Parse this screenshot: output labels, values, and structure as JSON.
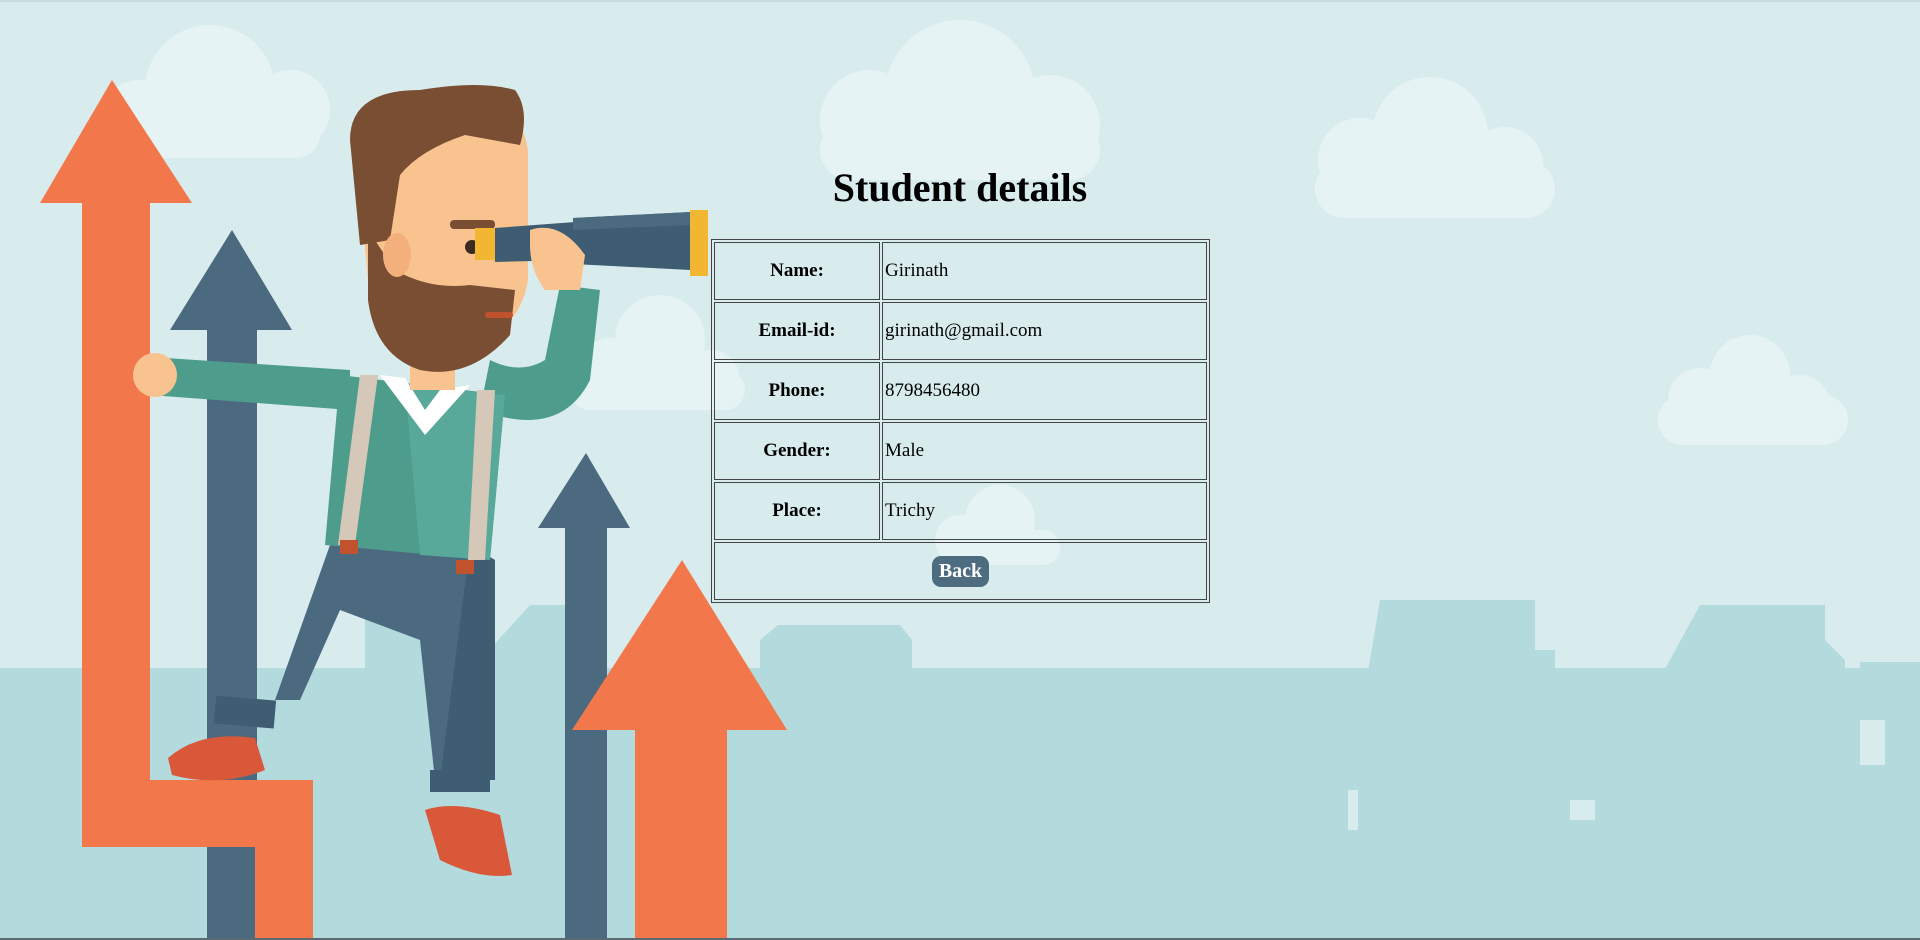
{
  "page": {
    "title": "Student details"
  },
  "details": {
    "rows": [
      {
        "label": "Name:",
        "value": "Girinath"
      },
      {
        "label": "Email-id:",
        "value": "girinath@gmail.com"
      },
      {
        "label": "Phone:",
        "value": "8798456480"
      },
      {
        "label": "Gender:",
        "value": "Male"
      },
      {
        "label": "Place:",
        "value": "Trichy"
      }
    ],
    "back_label": "Back"
  },
  "illustration": {
    "icon": "man-with-telescope-on-arrows-illustration",
    "colors": {
      "sky": "#d8ecee",
      "cloud": "#e6f3f4",
      "city": "#b3dadd",
      "arrow_orange": "#f2784b",
      "arrow_navy": "#4b6a80",
      "shirt": "#4e9d8c",
      "beard": "#7a4e32",
      "skin": "#f9c38f"
    }
  },
  "theme": {
    "button_bg": "#4e6c80"
  }
}
